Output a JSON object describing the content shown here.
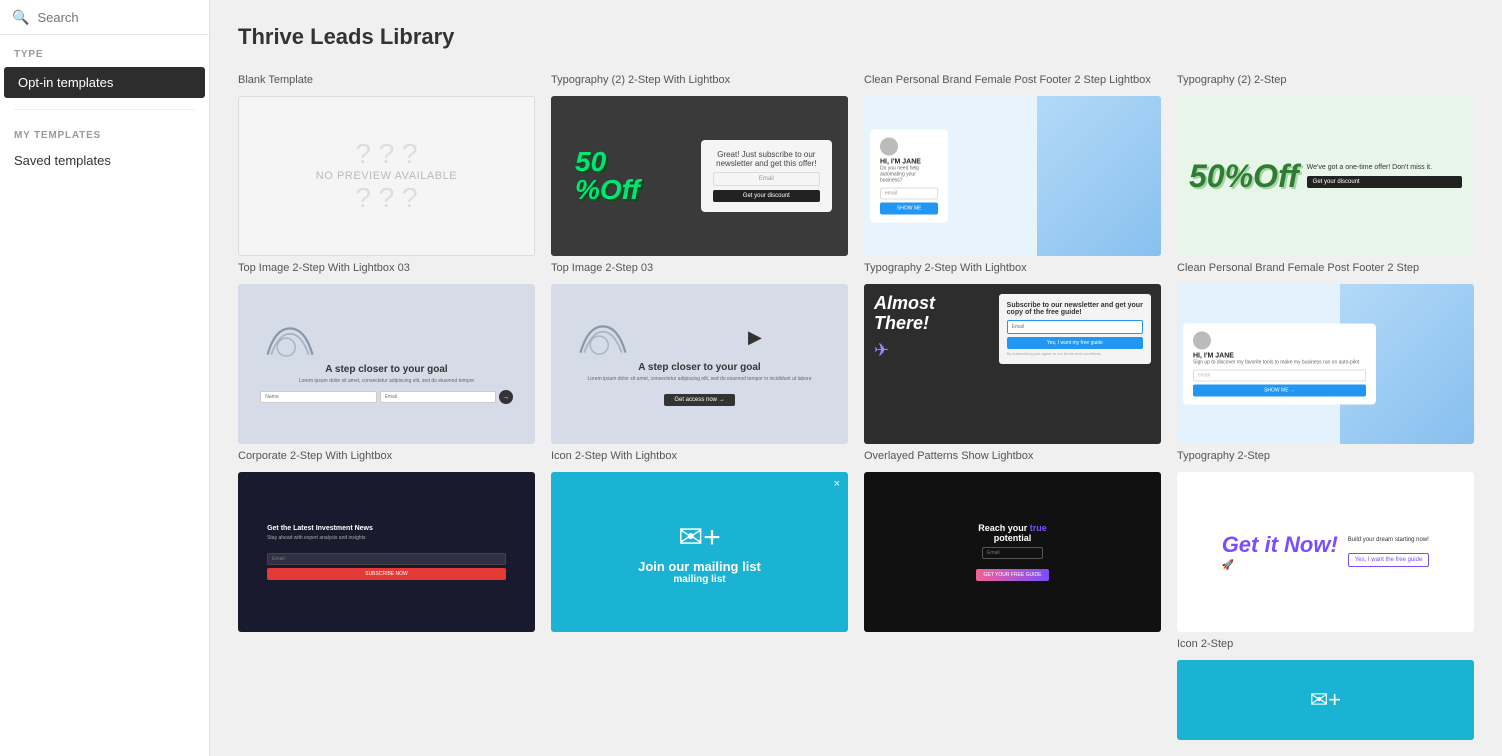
{
  "sidebar": {
    "search_placeholder": "Search",
    "close_icon": "×",
    "type_label": "TYPE",
    "opt_in_label": "Opt-in templates",
    "my_templates_label": "MY TEMPLATES",
    "saved_templates_label": "Saved templates"
  },
  "main": {
    "title": "Thrive Leads Library",
    "templates": [
      {
        "id": "blank",
        "name": "Blank Template",
        "preview_text": "NO PREVIEW AVAILABLE"
      },
      {
        "id": "top-image-2step-03",
        "name": "Top Image 2-Step With Lightbox 03",
        "tagline": "A step closer to your goal"
      },
      {
        "id": "corporate-2step",
        "name": "Corporate 2-Step With Lightbox",
        "news_label": "Get the Latest Investment News"
      },
      {
        "id": "typography-2step-lightbox",
        "name": "Typography (2) 2-Step With Lightbox",
        "offer": "50% Off"
      },
      {
        "id": "top-image-2step-03b",
        "name": "Top Image 2-Step 03",
        "tagline": "A step closer to your goal",
        "get_access": "Get access now →"
      },
      {
        "id": "icon-2step-lightbox",
        "name": "Icon 2-Step With Lightbox",
        "join_title": "Join our mailing list"
      },
      {
        "id": "clean-personal-brand",
        "name": "Clean Personal Brand Female Post Footer 2 Step Lightbox",
        "hi_text": "HI, I'M JANE",
        "sub_text": "Do you need help automating your business?",
        "show_btn": "SHOW ME"
      },
      {
        "id": "typography-2step-lightbox-2",
        "name": "Typography 2-Step With Lightbox",
        "almost": "Almost There!"
      },
      {
        "id": "overlayed-patterns",
        "name": "Overlayed Patterns Show Lightbox",
        "reach": "Reach your true potential"
      },
      {
        "id": "typography-2step-right",
        "name": "Typography (2) 2-Step",
        "offer": "50%Off"
      },
      {
        "id": "clean-personal-brand-2",
        "name": "Clean Personal Brand Female Post Footer 2 Step",
        "hi_text": "HI, I'M JANE",
        "sub_text": "Sign up to discover my favorite tools to make my business run on auto-pilot",
        "show_btn": "SHOW ME →"
      },
      {
        "id": "typography-2step",
        "name": "Typography 2-Step",
        "get_it": "Get it Now!",
        "sub": "Build your dream starting now!",
        "btn": "Yes, I want the free guide"
      },
      {
        "id": "icon-2step",
        "name": "Icon 2-Step"
      }
    ]
  }
}
